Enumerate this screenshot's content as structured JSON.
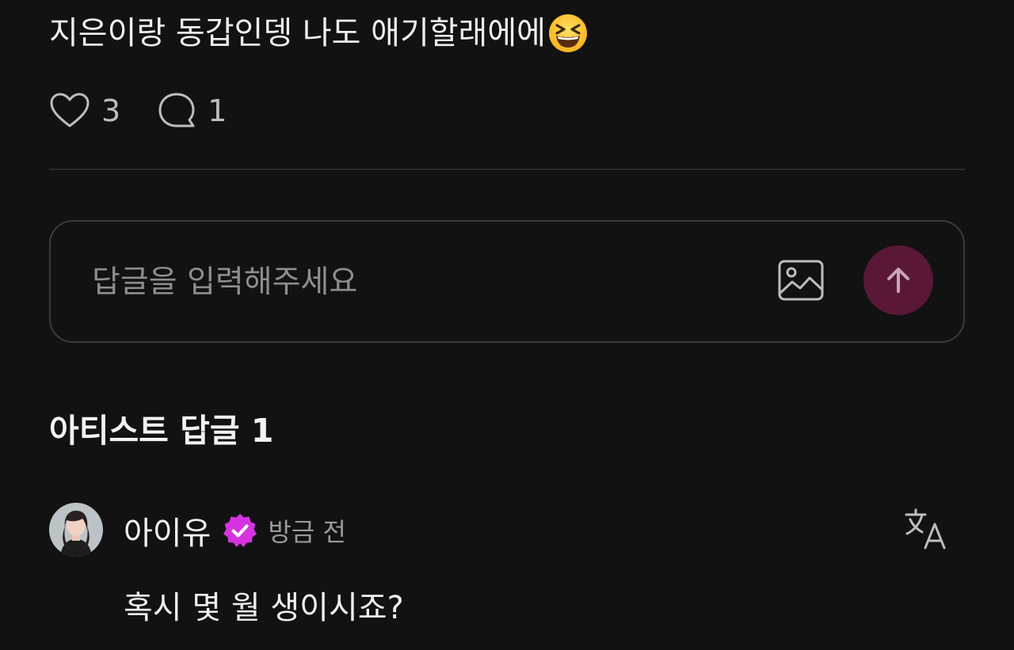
{
  "post": {
    "text": "지은이랑 동갑인뎅 나도 애기할래에에",
    "emoji": "grinning-squinting-face-emoji",
    "like_count": "3",
    "comment_count": "1"
  },
  "reply_box": {
    "placeholder": "답글을 입력해주세요",
    "value": "",
    "send_color": "#5a1836"
  },
  "artist_replies": {
    "title": "아티스트 답글 1",
    "items": [
      {
        "author": "아이유",
        "verified_color": "#d633e0",
        "time": "방금 전",
        "text": "혹시 몇 월 생이시죠?"
      }
    ]
  },
  "icons": {
    "like": "heart-icon",
    "comment": "speech-bubble-icon",
    "image": "image-icon",
    "send": "arrow-up-icon",
    "verified": "verified-badge-icon",
    "translate": "translate-icon"
  }
}
